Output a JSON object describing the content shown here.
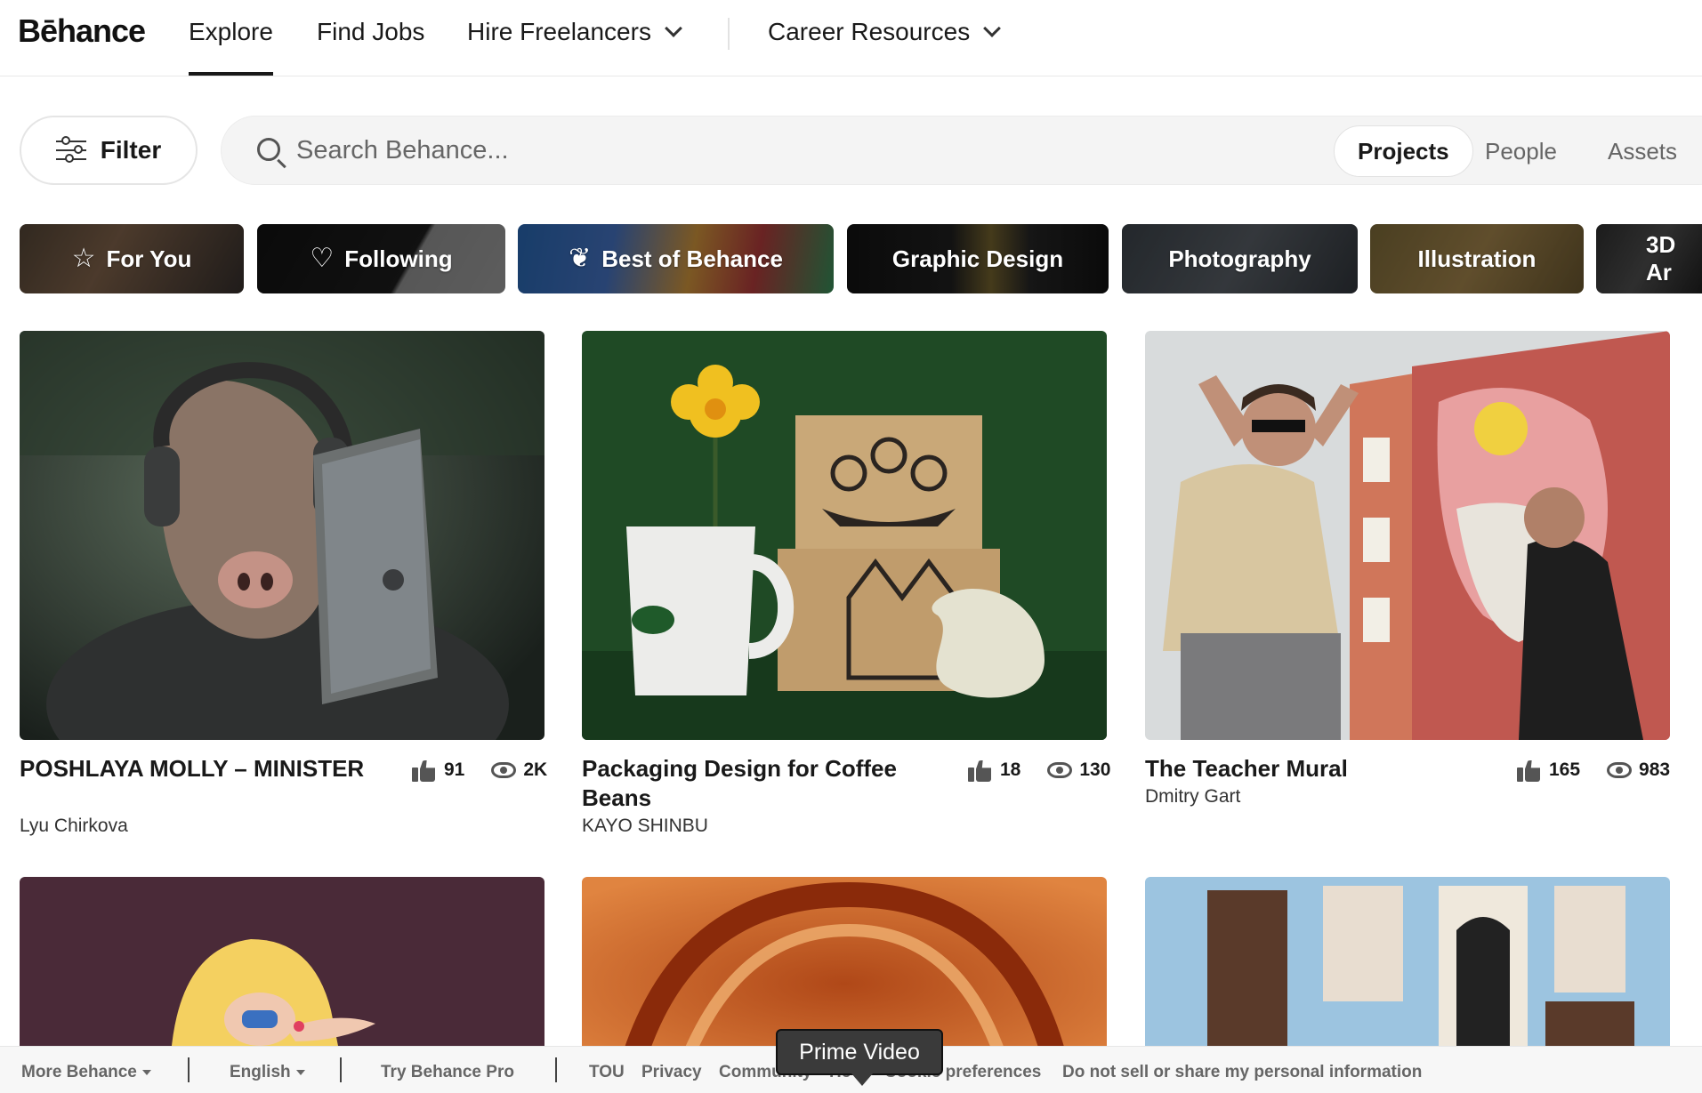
{
  "nav": {
    "logo": "Bēhance",
    "items": [
      {
        "label": "Explore",
        "active": true
      },
      {
        "label": "Find Jobs"
      },
      {
        "label": "Hire Freelancers"
      },
      {
        "label": "Career Resources"
      }
    ]
  },
  "toolbar": {
    "filter_label": "Filter",
    "search_placeholder": "Search Behance...",
    "segments": [
      "Projects",
      "People",
      "Assets"
    ]
  },
  "categories": [
    {
      "label": "For You",
      "icon": "star-icon"
    },
    {
      "label": "Following",
      "icon": "heart-icon"
    },
    {
      "label": "Best of Behance",
      "icon": "laurel-icon"
    },
    {
      "label": "Graphic Design"
    },
    {
      "label": "Photography"
    },
    {
      "label": "Illustration"
    },
    {
      "label": "3D Ar"
    }
  ],
  "projects": [
    {
      "title": "POSHLAYA MOLLY – MINISTER",
      "owner": "Lyu Chirkova",
      "likes": "91",
      "views": "2K"
    },
    {
      "title": "Packaging Design for Coffee Beans",
      "owner": "KAYO SHINBU",
      "likes": "18",
      "views": "130"
    },
    {
      "title": "The Teacher Mural",
      "owner": "Dmitry Gart",
      "likes": "165",
      "views": "983"
    }
  ],
  "footer": {
    "more": "More Behance",
    "language": "English",
    "pro": "Try Behance Pro",
    "tou": "TOU",
    "privacy": "Privacy",
    "community": "Community",
    "help": "He",
    "cookie": "Cookie preferences",
    "donotsell": "Do not sell or share my personal information"
  },
  "tooltip": "Prime Video"
}
